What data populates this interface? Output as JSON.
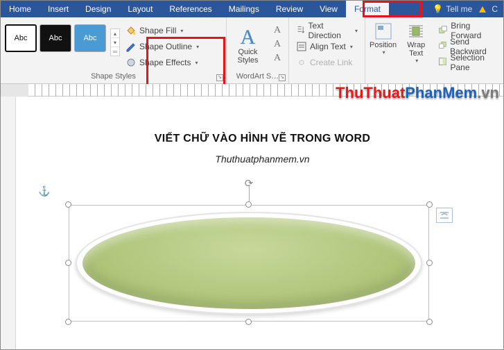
{
  "tabs": {
    "home": "Home",
    "insert": "Insert",
    "design": "Design",
    "layout": "Layout",
    "references": "References",
    "mailings": "Mailings",
    "review": "Review",
    "view": "View",
    "format": "Format",
    "tellme_prefix": "Tell me",
    "share_suffix": "C"
  },
  "ribbon": {
    "shape_styles": {
      "group_label": "Shape Styles",
      "swatch_text": "Abc",
      "fill": "Shape Fill",
      "outline": "Shape Outline",
      "effects": "Shape Effects"
    },
    "wordart": {
      "group_label": "WordArt S…",
      "quick_styles": "Quick Styles"
    },
    "text": {
      "direction": "Text Direction",
      "align": "Align Text",
      "create_link": "Create Link"
    },
    "arrange": {
      "position": "Position",
      "wrap": "Wrap Text",
      "bring_forward": "Bring Forward",
      "send_backward": "Send Backward",
      "selection_pane": "Selection Pane"
    }
  },
  "document": {
    "title": "VIẾT CHỮ VÀO HÌNH VẼ TRONG WORD",
    "subtitle": "Thuthuatphanmem.vn"
  },
  "watermark": {
    "part1": "ThuThuat",
    "part2": "PhanMem",
    "part3": ".vn"
  }
}
